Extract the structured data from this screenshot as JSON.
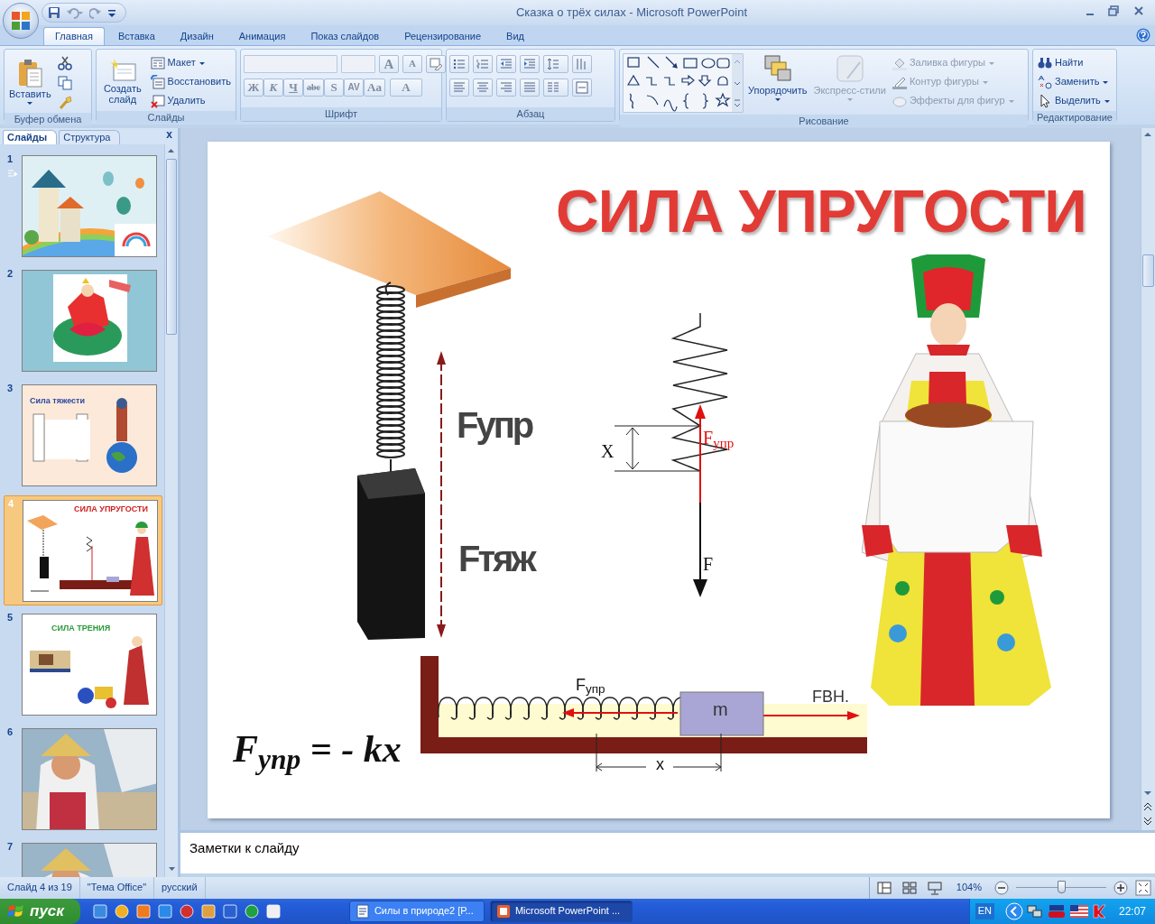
{
  "window": {
    "title": "Сказка о трёх силах - Microsoft PowerPoint"
  },
  "ribbon_tabs": [
    {
      "label": "Главная",
      "selected": true
    },
    {
      "label": "Вставка",
      "selected": false
    },
    {
      "label": "Дизайн",
      "selected": false
    },
    {
      "label": "Анимация",
      "selected": false
    },
    {
      "label": "Показ слайдов",
      "selected": false
    },
    {
      "label": "Рецензирование",
      "selected": false
    },
    {
      "label": "Вид",
      "selected": false
    }
  ],
  "ribbon": {
    "clipboard": {
      "label": "Буфер обмена",
      "paste": "Вставить"
    },
    "slides": {
      "label": "Слайды",
      "new_slide": "Создать слайд",
      "items": [
        "Макет",
        "Восстановить",
        "Удалить"
      ]
    },
    "font": {
      "label": "Шрифт",
      "size_buttons": [
        "A",
        "A"
      ],
      "format_buttons": [
        "Ж",
        "К",
        "Ч",
        "abc",
        "S",
        "AV",
        "Aa",
        "A"
      ]
    },
    "paragraph": {
      "label": "Абзац"
    },
    "drawing": {
      "label": "Рисование",
      "arrange": "Упорядочить",
      "quick_styles": {
        "label": "Экспресс-стили",
        "disabled": true
      },
      "items": [
        {
          "label": "Заливка фигуры",
          "disabled": true
        },
        {
          "label": "Контур фигуры",
          "disabled": true
        },
        {
          "label": "Эффекты для фигур",
          "disabled": true
        }
      ]
    },
    "editing": {
      "label": "Редактирование",
      "items": [
        "Найти",
        "Заменить",
        "Выделить"
      ]
    }
  },
  "panel": {
    "tabs": [
      {
        "label": "Слайды",
        "selected": true
      },
      {
        "label": "Структура",
        "selected": false
      }
    ],
    "close": "x",
    "slides": [
      {
        "number": "1",
        "selected": false,
        "kind": "scene"
      },
      {
        "number": "2",
        "selected": false,
        "kind": "logo"
      },
      {
        "number": "3",
        "selected": false,
        "kind": "peach",
        "title": "Сила тяжести"
      },
      {
        "number": "4",
        "selected": true,
        "kind": "springs",
        "title": "СИЛА УПРУГОСТИ"
      },
      {
        "number": "5",
        "selected": false,
        "kind": "friction",
        "title": "СИЛА ТРЕНИЯ"
      },
      {
        "number": "6",
        "selected": false,
        "kind": "cartoon"
      },
      {
        "number": "7",
        "selected": false,
        "kind": "cartoon"
      }
    ]
  },
  "slide": {
    "title": "СИЛА УПРУГОСТИ",
    "hanging_spring": {
      "upper_force": "Fупр",
      "lower_force": "Fтяж"
    },
    "spring_diagram": {
      "displacement": "X",
      "elastic_force": "F$_{упр}$",
      "force": "F"
    },
    "horizontal_spring": {
      "elastic_force": "F$_{упр}$",
      "mass": "m",
      "external_force": "FВН.",
      "displacement": "x"
    },
    "formula": "F$_{упр}$ = - kx"
  },
  "notes": {
    "text": "Заметки к слайду"
  },
  "status_bar": {
    "slide": "Слайд 4 из 19",
    "theme": "\"Тема Office\"",
    "language": "русский",
    "zoom": "104%",
    "zoom_slider": {
      "level": 0.5
    }
  },
  "taskbar": {
    "start": "пуск",
    "tasks": [
      {
        "label": "Силы в природе2 [Р...",
        "selected": false
      },
      {
        "label": "Microsoft PowerPoint ...",
        "selected": true
      }
    ],
    "language": "EN",
    "clock": "22:07"
  }
}
